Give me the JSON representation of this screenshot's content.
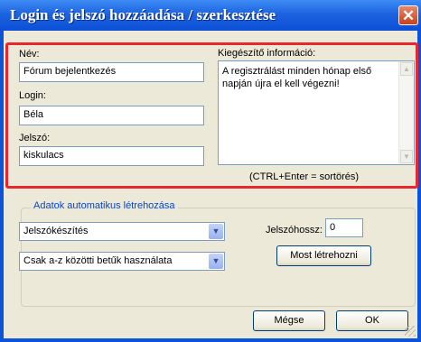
{
  "window": {
    "title": "Login és jelszó hozzáadása / szerkesztése",
    "close_glyph": "✕"
  },
  "fields": {
    "name_label": "Név:",
    "name_value": "Fórum bejelentkezés",
    "login_label": "Login:",
    "login_value": "Béla",
    "password_label": "Jelszó:",
    "password_value": "kiskulacs"
  },
  "extra": {
    "label": "Kiegészítő információ:",
    "text": "A regisztrálást minden hónap első napján újra el kell végezni!",
    "hint": "(CTRL+Enter = sortörés)"
  },
  "auto": {
    "group_title": "Adatok automatikus létrehozása",
    "mode_select": "Jelszókészítés",
    "charset_select": "Csak a-z közötti betűk használata",
    "length_label": "Jelszóhossz:",
    "length_value": "0",
    "generate_button": "Most létrehozni"
  },
  "buttons": {
    "cancel": "Mégse",
    "ok": "OK"
  },
  "icons": {
    "close": "close-icon",
    "dropdown": "chevron-down-icon",
    "scroll_up": "arrow-up-icon",
    "scroll_down": "arrow-down-icon",
    "grip": "resize-grip-icon"
  },
  "colors": {
    "titlebar": "#0a4fd5",
    "highlight": "#e8262c",
    "group_title": "#0046d5",
    "client": "#ece9d8"
  }
}
